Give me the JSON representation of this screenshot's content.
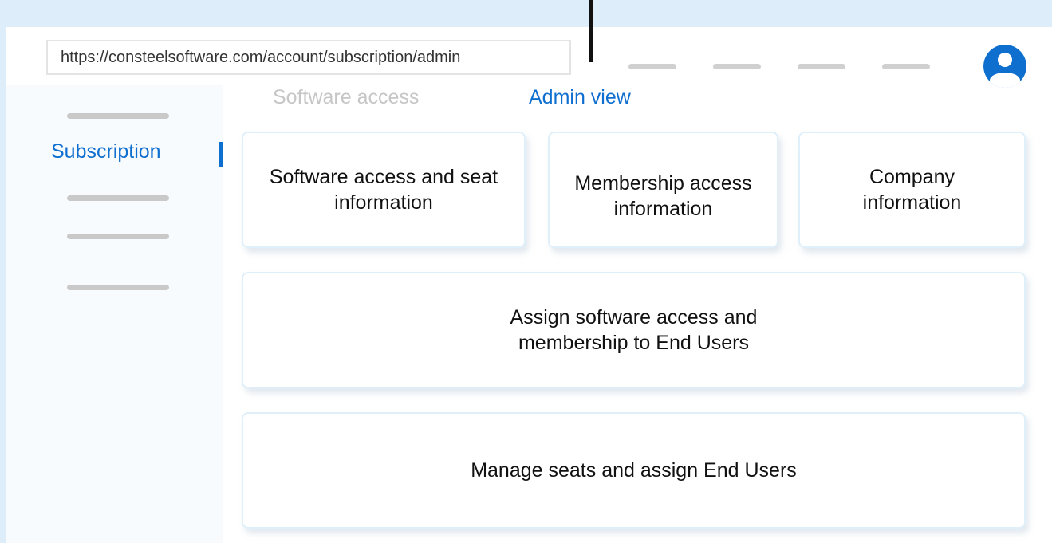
{
  "browser": {
    "url": "https://consteelsoftware.com/account/subscription/admin"
  },
  "tabs": [
    {
      "label": "Software access",
      "active": false
    },
    {
      "label": "Admin view",
      "active": true
    }
  ],
  "sidebar": {
    "active_item": "Subscription"
  },
  "cards": [
    {
      "label": "Software access and seat information"
    },
    {
      "label": "Membership access information"
    },
    {
      "label": "Company information"
    },
    {
      "label": "Assign software access and membership to End Users"
    },
    {
      "label": "Manage seats and assign End Users"
    }
  ],
  "colors": {
    "accent": "#0f6fcf",
    "background": "#ddeefa",
    "avatar": "#0f6fcf"
  },
  "icons": {
    "avatar": "user-icon"
  }
}
